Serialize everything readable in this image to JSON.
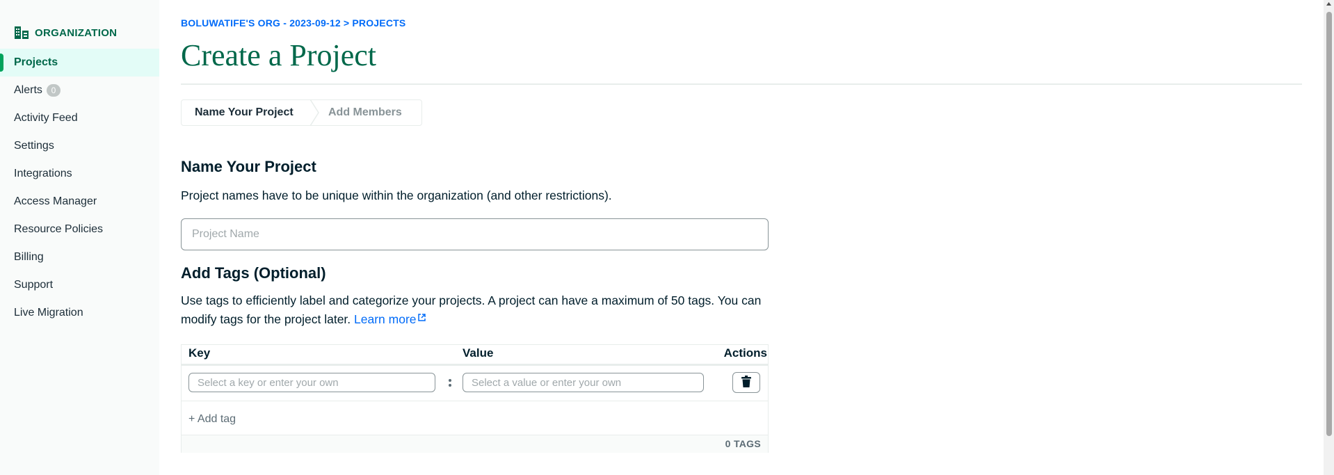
{
  "sidebar": {
    "org_label": "ORGANIZATION",
    "org_icon": "organization-building-icon",
    "items": [
      {
        "label": "Projects",
        "active": true
      },
      {
        "label": "Alerts",
        "badge": "0"
      },
      {
        "label": "Activity Feed"
      },
      {
        "label": "Settings"
      },
      {
        "label": "Integrations"
      },
      {
        "label": "Access Manager"
      },
      {
        "label": "Resource Policies"
      },
      {
        "label": "Billing"
      },
      {
        "label": "Support"
      },
      {
        "label": "Live Migration"
      }
    ]
  },
  "header": {
    "breadcrumb": "BOLUWATIFE'S ORG - 2023-09-12 > PROJECTS",
    "title": "Create a Project"
  },
  "stepper": {
    "steps": [
      "Name Your Project",
      "Add Members"
    ],
    "current": 0
  },
  "name_section": {
    "heading": "Name Your Project",
    "description": "Project names have to be unique within the organization (and other restrictions).",
    "input_placeholder": "Project Name",
    "input_value": ""
  },
  "tags_section": {
    "heading": "Add Tags (Optional)",
    "description": "Use tags to efficiently label and categorize your projects. A project can have a maximum of 50 tags. You can modify tags for the project later.",
    "learn_more": "Learn more",
    "learn_more_icon": "external-link-icon",
    "columns": [
      "Key",
      "Value",
      "Actions"
    ],
    "key_placeholder": "Select a key or enter your own",
    "value_placeholder": "Select a value or enter your own",
    "delete_icon": "trash-icon",
    "add_tag": "+ Add tag",
    "count": "0 TAGS"
  },
  "colors": {
    "brand_green": "#00684a",
    "active_bg": "#e3fcf7",
    "link_blue": "#016bf8"
  }
}
